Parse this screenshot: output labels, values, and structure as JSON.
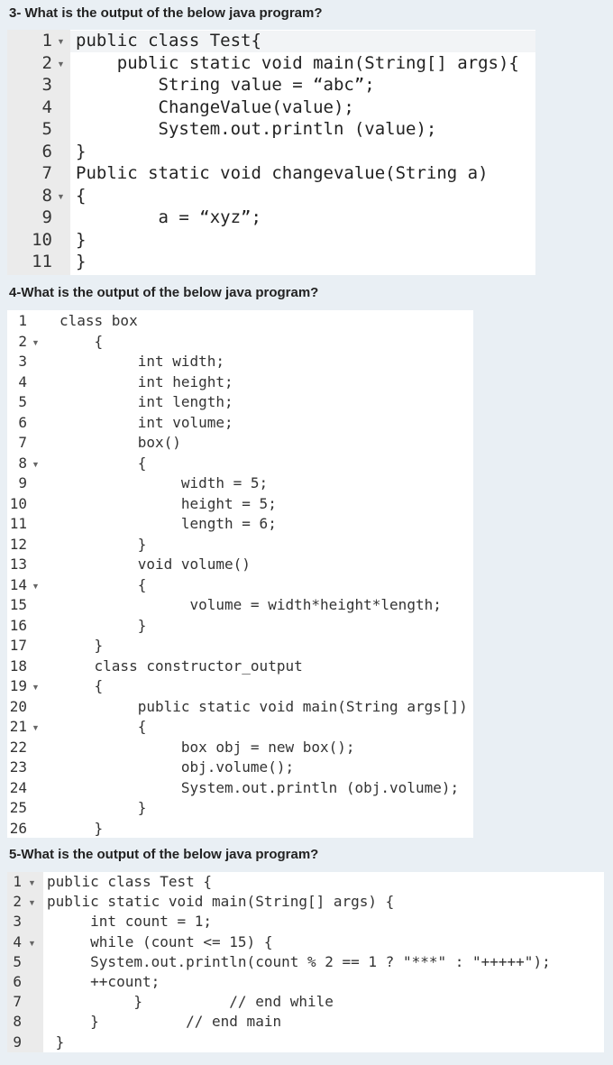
{
  "questions": {
    "q3": "3- What is the output of the below java program?",
    "q4": "4-What is the output of the below java program?",
    "q5": "5-What is the output of the below java program?"
  },
  "editor1": {
    "lines": [
      {
        "n": "1",
        "fold": true,
        "code": "public class Test{"
      },
      {
        "n": "2",
        "fold": true,
        "code": "    public static void main(String[] args){"
      },
      {
        "n": "3",
        "fold": false,
        "code": "        String value = “abc”;"
      },
      {
        "n": "4",
        "fold": false,
        "code": "        ChangeValue(value);"
      },
      {
        "n": "5",
        "fold": false,
        "code": "        System.out.println (value);"
      },
      {
        "n": "6",
        "fold": false,
        "code": "}"
      },
      {
        "n": "7",
        "fold": false,
        "code": "Public static void changevalue(String a)"
      },
      {
        "n": "8",
        "fold": true,
        "code": "{"
      },
      {
        "n": "9",
        "fold": false,
        "code": "        a = “xyz”;"
      },
      {
        "n": "10",
        "fold": false,
        "code": "}"
      },
      {
        "n": "11",
        "fold": false,
        "code": "}"
      }
    ]
  },
  "editor2": {
    "lines": [
      {
        "n": "1",
        "fold": false,
        "code": "class box"
      },
      {
        "n": "2",
        "fold": true,
        "code": "    {"
      },
      {
        "n": "3",
        "fold": false,
        "code": "         int width;"
      },
      {
        "n": "4",
        "fold": false,
        "code": "         int height;"
      },
      {
        "n": "5",
        "fold": false,
        "code": "         int length;"
      },
      {
        "n": "6",
        "fold": false,
        "code": "         int volume;"
      },
      {
        "n": "7",
        "fold": false,
        "code": "         box()"
      },
      {
        "n": "8",
        "fold": true,
        "code": "         {"
      },
      {
        "n": "9",
        "fold": false,
        "code": "              width = 5;"
      },
      {
        "n": "10",
        "fold": false,
        "code": "              height = 5;"
      },
      {
        "n": "11",
        "fold": false,
        "code": "              length = 6;"
      },
      {
        "n": "12",
        "fold": false,
        "code": "         }"
      },
      {
        "n": "13",
        "fold": false,
        "code": "         void volume()"
      },
      {
        "n": "14",
        "fold": true,
        "code": "         {"
      },
      {
        "n": "15",
        "fold": false,
        "code": "               volume = width*height*length;"
      },
      {
        "n": "16",
        "fold": false,
        "code": "         }"
      },
      {
        "n": "17",
        "fold": false,
        "code": "    }"
      },
      {
        "n": "18",
        "fold": false,
        "code": "    class constructor_output"
      },
      {
        "n": "19",
        "fold": true,
        "code": "    {"
      },
      {
        "n": "20",
        "fold": false,
        "code": "         public static void main(String args[])"
      },
      {
        "n": "21",
        "fold": true,
        "code": "         {"
      },
      {
        "n": "22",
        "fold": false,
        "code": "              box obj = new box();"
      },
      {
        "n": "23",
        "fold": false,
        "code": "              obj.volume();"
      },
      {
        "n": "24",
        "fold": false,
        "code": "              System.out.println (obj.volume);"
      },
      {
        "n": "25",
        "fold": false,
        "code": "         }"
      },
      {
        "n": "26",
        "fold": false,
        "code": "    }"
      }
    ]
  },
  "editor3": {
    "lines": [
      {
        "n": "1",
        "fold": true,
        "code": "public class Test {"
      },
      {
        "n": "2",
        "fold": true,
        "code": "public static void main(String[] args) {"
      },
      {
        "n": "3",
        "fold": false,
        "code": "     int count = 1;"
      },
      {
        "n": "4",
        "fold": true,
        "code": "     while (count <= 15) {"
      },
      {
        "n": "5",
        "fold": false,
        "code": "     System.out.println(count % 2 == 1 ? \"***\" : \"+++++\");"
      },
      {
        "n": "6",
        "fold": false,
        "code": "     ++count;"
      },
      {
        "n": "7",
        "fold": false,
        "code": "          }          // end while"
      },
      {
        "n": "8",
        "fold": false,
        "code": "     }          // end main"
      },
      {
        "n": "9",
        "fold": false,
        "code": " }"
      }
    ]
  }
}
